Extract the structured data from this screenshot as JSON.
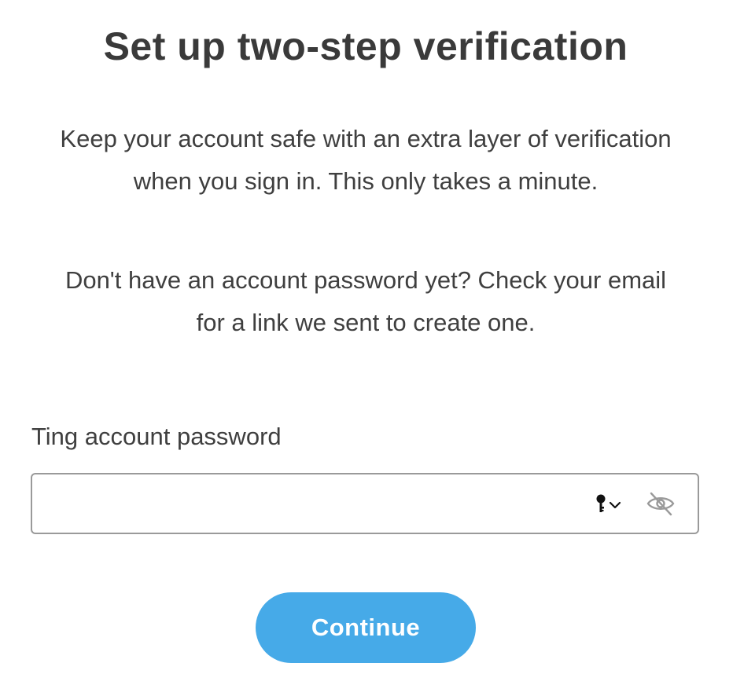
{
  "header": {
    "title": "Set up two-step verification"
  },
  "description": {
    "paragraph1": "Keep your account safe with an extra layer of verification when you sign in. This only takes a minute.",
    "paragraph2": "Don't have an account password yet? Check your email for a link we sent to create one."
  },
  "password_field": {
    "label": "Ting account password",
    "value": "",
    "placeholder": "",
    "key_icon": "key-autofill-icon",
    "visibility_icon": "eye-slash-icon"
  },
  "actions": {
    "continue_label": "Continue"
  },
  "colors": {
    "accent": "#46aae8",
    "text": "#3d3d3d",
    "border": "#9a9a9a"
  }
}
